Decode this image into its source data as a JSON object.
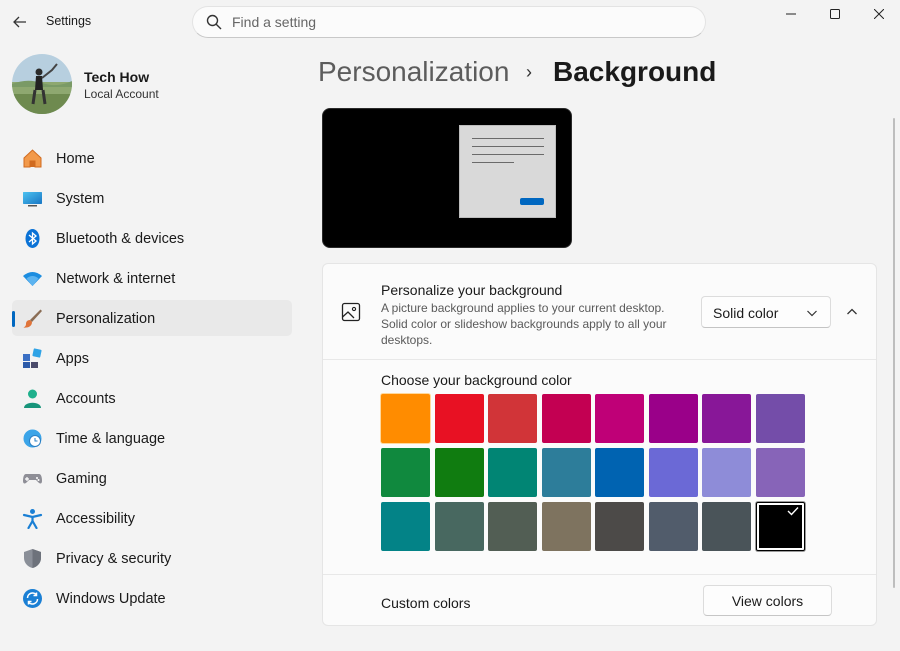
{
  "window": {
    "title": "Settings",
    "back_icon": "arrow-left-icon",
    "minimize_icon": "minimize-icon",
    "maximize_icon": "maximize-icon",
    "close_icon": "close-icon"
  },
  "search": {
    "placeholder": "Find a setting",
    "icon": "search-icon"
  },
  "profile": {
    "name": "Tech How",
    "account_type": "Local Account"
  },
  "sidebar": {
    "items": [
      {
        "label": "Home",
        "icon": "home-icon",
        "active": false
      },
      {
        "label": "System",
        "icon": "system-display-icon",
        "active": false
      },
      {
        "label": "Bluetooth & devices",
        "icon": "bluetooth-icon",
        "active": false
      },
      {
        "label": "Network & internet",
        "icon": "wifi-icon",
        "active": false
      },
      {
        "label": "Personalization",
        "icon": "brush-icon",
        "active": true
      },
      {
        "label": "Apps",
        "icon": "apps-icon",
        "active": false
      },
      {
        "label": "Accounts",
        "icon": "person-icon",
        "active": false
      },
      {
        "label": "Time & language",
        "icon": "globe-clock-icon",
        "active": false
      },
      {
        "label": "Gaming",
        "icon": "gamepad-icon",
        "active": false
      },
      {
        "label": "Accessibility",
        "icon": "accessibility-icon",
        "active": false
      },
      {
        "label": "Privacy & security",
        "icon": "shield-icon",
        "active": false
      },
      {
        "label": "Windows Update",
        "icon": "update-icon",
        "active": false
      }
    ]
  },
  "breadcrumb": {
    "parent": "Personalization",
    "separator": "›",
    "current": "Background"
  },
  "background_card": {
    "title": "Personalize your background",
    "description": "A picture background applies to your current desktop. Solid color or slideshow backgrounds apply to all your desktops.",
    "dropdown_value": "Solid color",
    "icon": "picture-icon",
    "palette_title": "Choose your background color",
    "swatches": [
      "#ff8c00",
      "#e81123",
      "#d13438",
      "#c30052",
      "#bf0077",
      "#9a0089",
      "#881798",
      "#744da9",
      "#10893e",
      "#107c10",
      "#018574",
      "#2d7d9a",
      "#0063b1",
      "#6b69d6",
      "#8e8cd8",
      "#8764b8",
      "#038387",
      "#486860",
      "#525e54",
      "#7e735f",
      "#4c4a48",
      "#515c6b",
      "#4a5459",
      "#000000"
    ],
    "selected_color": "#000000",
    "custom_colors_label": "Custom colors",
    "view_colors_button": "View colors"
  },
  "colors": {
    "accent": "#0067c0",
    "active_nav_bg": "#e9e9e9",
    "window_bg": "#f3f3f3"
  }
}
